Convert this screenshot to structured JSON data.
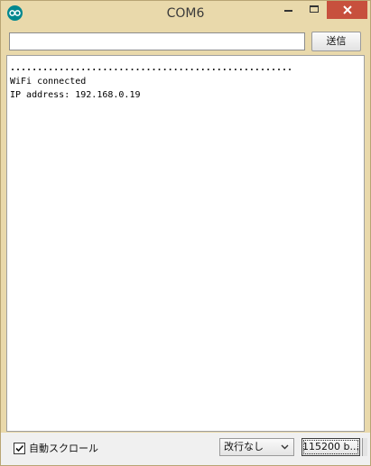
{
  "window": {
    "title": "COM6"
  },
  "send": {
    "input_value": "",
    "button_label": "送信"
  },
  "output": {
    "lines": [
      "....................................................",
      "WiFi connected",
      "IP address: 192.168.0.19"
    ]
  },
  "bottom": {
    "autoscroll_label": "自動スクロール",
    "autoscroll_checked": true,
    "line_ending_value": "改行なし",
    "baud_value": "115200 b..."
  },
  "colors": {
    "titlebar": "#e9d9ab",
    "close_button": "#c7503d",
    "arduino_icon": "#00878f"
  },
  "icons": {
    "app": "arduino-infinity-icon",
    "minimize": "minimize-icon",
    "maximize": "maximize-icon",
    "close": "close-icon",
    "check": "checkmark-icon",
    "dropdown": "chevron-down-icon"
  }
}
